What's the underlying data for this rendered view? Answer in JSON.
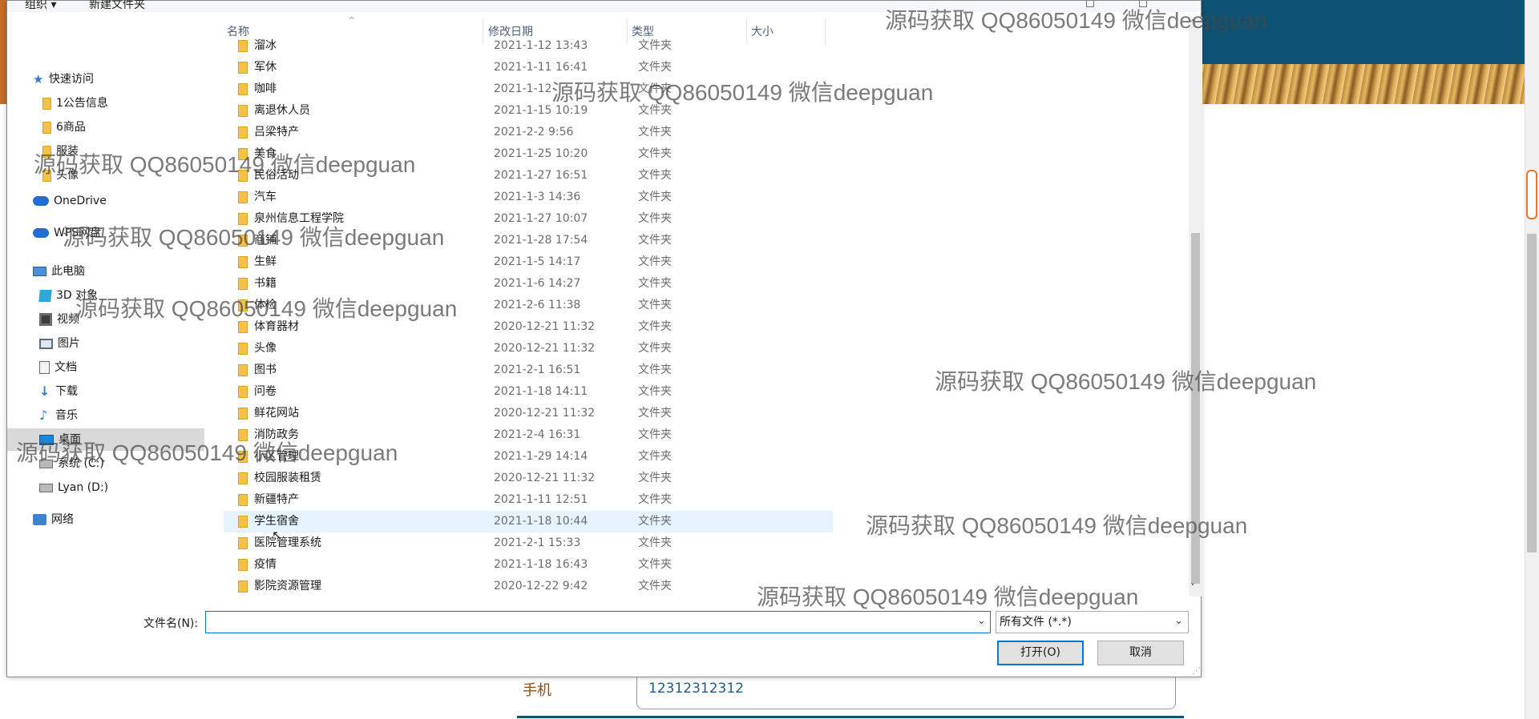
{
  "background_page": {
    "phone_label": "手机",
    "phone_value": "12312312312"
  },
  "dialog": {
    "toolbar": {
      "organize": "组织 ▾",
      "new_folder": "新建文件夹"
    },
    "nav": [
      {
        "label": "快速访问",
        "icon": "star-icon"
      },
      {
        "label": "1公告信息",
        "icon": "folder-icon"
      },
      {
        "label": "6商品",
        "icon": "folder-icon"
      },
      {
        "label": "服装",
        "icon": "folder-icon"
      },
      {
        "label": "头像",
        "icon": "folder-icon"
      },
      {
        "label": "OneDrive",
        "icon": "onedrive-icon"
      },
      {
        "label": "WPS网盘",
        "icon": "cloud-icon"
      },
      {
        "label": "此电脑",
        "icon": "pc-icon"
      },
      {
        "label": "3D 对象",
        "icon": "cube-icon"
      },
      {
        "label": "视频",
        "icon": "film-icon"
      },
      {
        "label": "图片",
        "icon": "picture-icon"
      },
      {
        "label": "文档",
        "icon": "document-icon"
      },
      {
        "label": "下载",
        "icon": "download-icon"
      },
      {
        "label": "音乐",
        "icon": "music-icon"
      },
      {
        "label": "桌面",
        "icon": "desktop-icon",
        "selected": true
      },
      {
        "label": "系统 (C:)",
        "icon": "drive-icon"
      },
      {
        "label": "Lyan (D:)",
        "icon": "drive-icon"
      },
      {
        "label": "网络",
        "icon": "network-icon"
      }
    ],
    "columns": {
      "name": "名称",
      "date": "修改日期",
      "type": "类型",
      "size": "大小"
    },
    "files": [
      {
        "name": "溜冰",
        "date": "2021-1-12 13:43",
        "type": "文件夹"
      },
      {
        "name": "军休",
        "date": "2021-1-11 16:41",
        "type": "文件夹"
      },
      {
        "name": "咖啡",
        "date": "2021-1-12",
        "type": "文件夹"
      },
      {
        "name": "离退休人员",
        "date": "2021-1-15 10:19",
        "type": "文件夹"
      },
      {
        "name": "吕梁特产",
        "date": "2021-2-2 9:56",
        "type": "文件夹"
      },
      {
        "name": "美食",
        "date": "2021-1-25 10:20",
        "type": "文件夹"
      },
      {
        "name": "民俗活动",
        "date": "2021-1-27 16:51",
        "type": "文件夹"
      },
      {
        "name": "汽车",
        "date": "2021-1-3 14:36",
        "type": "文件夹"
      },
      {
        "name": "泉州信息工程学院",
        "date": "2021-1-27 10:07",
        "type": "文件夹"
      },
      {
        "name": "商铺",
        "date": "2021-1-28 17:54",
        "type": "文件夹"
      },
      {
        "name": "生鲜",
        "date": "2021-1-5 14:17",
        "type": "文件夹"
      },
      {
        "name": "书籍",
        "date": "2021-1-6 14:27",
        "type": "文件夹"
      },
      {
        "name": "体检",
        "date": "2021-2-6 11:38",
        "type": "文件夹"
      },
      {
        "name": "体育器材",
        "date": "2020-12-21 11:32",
        "type": "文件夹"
      },
      {
        "name": "头像",
        "date": "2020-12-21 11:32",
        "type": "文件夹"
      },
      {
        "name": "图书",
        "date": "2021-2-1 16:51",
        "type": "文件夹"
      },
      {
        "name": "问卷",
        "date": "2021-1-18 14:11",
        "type": "文件夹"
      },
      {
        "name": "鲜花网站",
        "date": "2020-12-21 11:32",
        "type": "文件夹"
      },
      {
        "name": "消防政务",
        "date": "2021-2-4 16:31",
        "type": "文件夹"
      },
      {
        "name": "小区管理",
        "date": "2021-1-29 14:14",
        "type": "文件夹"
      },
      {
        "name": "校园服装租赁",
        "date": "2020-12-21 11:32",
        "type": "文件夹"
      },
      {
        "name": "新疆特产",
        "date": "2021-1-11 12:51",
        "type": "文件夹"
      },
      {
        "name": "学生宿舍",
        "date": "2021-1-18 10:44",
        "type": "文件夹",
        "hovered": true
      },
      {
        "name": "医院管理系统",
        "date": "2021-2-1 15:33",
        "type": "文件夹"
      },
      {
        "name": "疫情",
        "date": "2021-1-18 16:43",
        "type": "文件夹"
      },
      {
        "name": "影院资源管理",
        "date": "2020-12-22 9:42",
        "type": "文件夹"
      }
    ],
    "filename_label": "文件名(N):",
    "filename_value": "",
    "filetype": "所有文件 (*.*)",
    "open_button": "打开(O)",
    "cancel_button": "取消"
  },
  "watermark_text": "源码获取 QQ86050149 微信deepguan",
  "colors": {
    "header_bg": "#0d5273",
    "accent": "#0078d7",
    "selected": "#d9d9d9",
    "hover": "#e5f3fe"
  }
}
